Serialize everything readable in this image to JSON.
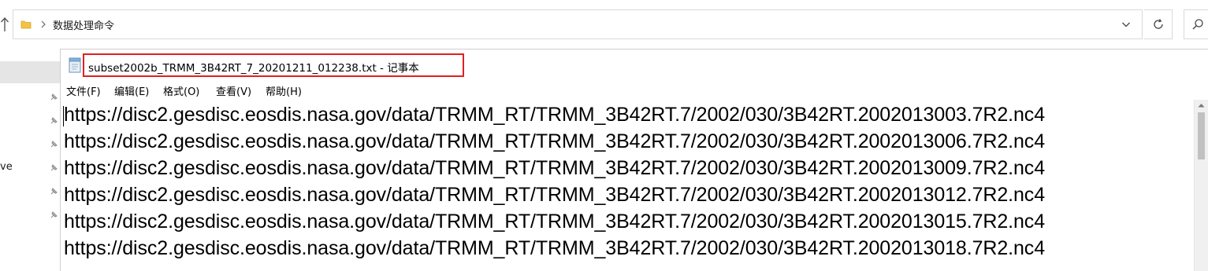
{
  "explorer": {
    "path": "数据处理命令",
    "sidebar_text": "ve"
  },
  "notepad": {
    "title": "subset2002b_TRMM_3B42RT_7_20201211_012238.txt - 记事本",
    "menu": [
      {
        "label": "文件(F)"
      },
      {
        "label": "编辑(E)"
      },
      {
        "label": "格式(O)"
      },
      {
        "label": "查看(V)"
      },
      {
        "label": "帮助(H)"
      }
    ],
    "lines": [
      "https://disc2.gesdisc.eosdis.nasa.gov/data/TRMM_RT/TRMM_3B42RT.7/2002/030/3B42RT.2002013003.7R2.nc4",
      "https://disc2.gesdisc.eosdis.nasa.gov/data/TRMM_RT/TRMM_3B42RT.7/2002/030/3B42RT.2002013006.7R2.nc4",
      "https://disc2.gesdisc.eosdis.nasa.gov/data/TRMM_RT/TRMM_3B42RT.7/2002/030/3B42RT.2002013009.7R2.nc4",
      "https://disc2.gesdisc.eosdis.nasa.gov/data/TRMM_RT/TRMM_3B42RT.7/2002/030/3B42RT.2002013012.7R2.nc4",
      "https://disc2.gesdisc.eosdis.nasa.gov/data/TRMM_RT/TRMM_3B42RT.7/2002/030/3B42RT.2002013015.7R2.nc4",
      "https://disc2.gesdisc.eosdis.nasa.gov/data/TRMM_RT/TRMM_3B42RT.7/2002/030/3B42RT.2002013018.7R2.nc4"
    ]
  },
  "colors": {
    "highlight_border": "#e02020",
    "folder": "#f2c244"
  },
  "icons": {
    "up": "up-arrow-icon",
    "folder": "folder-icon",
    "chevron": "chevron-right-icon",
    "dropdown": "chevron-down-icon",
    "refresh": "refresh-icon",
    "search": "search-icon",
    "pin": "pin-icon",
    "notepad": "notepad-icon"
  }
}
